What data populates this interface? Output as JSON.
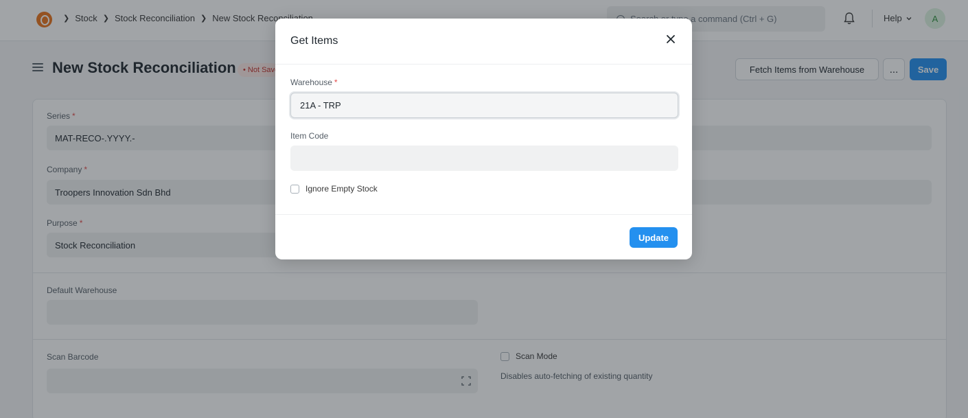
{
  "navbar": {
    "breadcrumbs": [
      "Stock",
      "Stock Reconciliation",
      "New Stock Reconciliation"
    ],
    "search_placeholder": "Search or type a command (Ctrl + G)",
    "help_label": "Help",
    "avatar_initial": "A"
  },
  "page": {
    "title": "New Stock Reconciliation",
    "status": "Not Saved",
    "fetch_button": "Fetch Items from Warehouse",
    "more_button": "...",
    "save_button": "Save"
  },
  "form": {
    "series": {
      "label": "Series",
      "value": "MAT-RECO-.YYYY.-"
    },
    "company": {
      "label": "Company",
      "value": "Troopers Innovation Sdn Bhd"
    },
    "purpose": {
      "label": "Purpose",
      "value": "Stock Reconciliation"
    },
    "default_warehouse": {
      "label": "Default Warehouse",
      "value": ""
    },
    "scan_barcode": {
      "label": "Scan Barcode",
      "value": ""
    },
    "scan_mode": {
      "label": "Scan Mode",
      "description": "Disables auto-fetching of existing quantity"
    },
    "required_mark": "*"
  },
  "modal": {
    "title": "Get Items",
    "warehouse": {
      "label": "Warehouse",
      "value": "21A - TRP"
    },
    "item_code": {
      "label": "Item Code",
      "value": ""
    },
    "ignore_empty_stock": {
      "label": "Ignore Empty Stock"
    },
    "update_button": "Update"
  },
  "colors": {
    "primary": "#2490ef",
    "required": "#e24c4b",
    "status_bg": "#fde8e5",
    "status_text": "#c4302a",
    "logo": "#e8731a"
  }
}
